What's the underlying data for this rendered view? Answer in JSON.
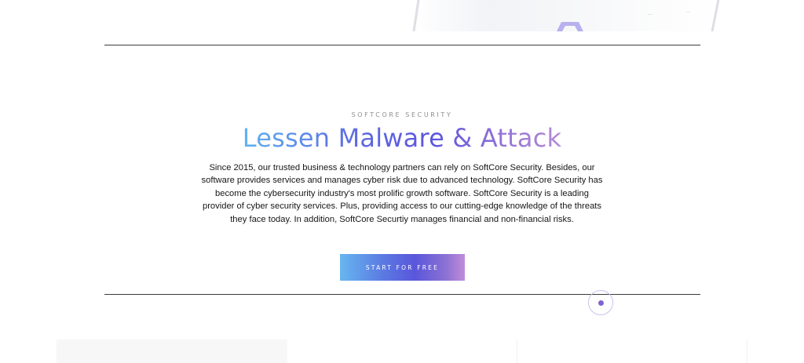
{
  "hero": {
    "eyebrow": "SOFTCORE SECURITY",
    "headline": "Lessen Malware & Attack",
    "body": "Since 2015, our trusted business & technology partners can rely on SoftCore Security. Besides, our software provides services and manages cyber risk due to advanced technology. SoftCore Security has become the cybersecurity industry's most prolific growth software. SoftCore Security is a leading provider of cyber security services. Plus, providing access to our cutting-edge knowledge of the threats they face today. In addition, SoftCore Securtiy manages financial and non-financial risks.",
    "cta_label": "START FOR FREE"
  },
  "colors": {
    "gradient_start": "#62b3f0",
    "gradient_mid": "#5a56db",
    "gradient_end": "#c08cd9",
    "divider": "#3b3b3b",
    "eyebrow": "#8d8d8d",
    "scroll_dot": "#7f63d3"
  },
  "icons": {
    "scroll_indicator": "scroll-dot-icon",
    "device_graphic": "device-illustration"
  }
}
